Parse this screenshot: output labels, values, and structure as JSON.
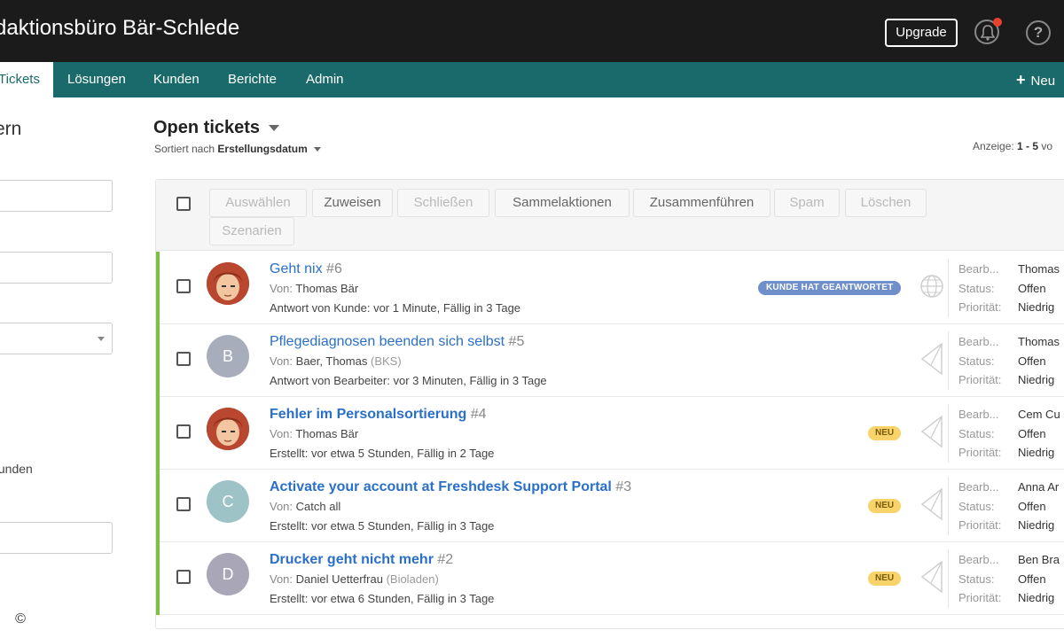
{
  "header": {
    "brand": "daktionsbüro Bär-Schlede",
    "upgrade_label": "Upgrade",
    "help_glyph": "?"
  },
  "nav": {
    "items": [
      {
        "label": "Tickets",
        "active": true
      },
      {
        "label": "Lösungen"
      },
      {
        "label": "Kunden"
      },
      {
        "label": "Berichte"
      },
      {
        "label": "Admin"
      }
    ],
    "new_icon": "+",
    "new_label": "Neu"
  },
  "sidebar": {
    "title": "ern",
    "text": "tunden",
    "copyright": "©"
  },
  "main": {
    "title": "Open tickets",
    "sort_prefix": "Sortiert nach",
    "sort_value": "Erstellungsdatum",
    "display_prefix": "Anzeige:",
    "display_value": "1 - 5",
    "display_suffix": "vo"
  },
  "toolbar": {
    "buttons": [
      "Auswählen",
      "Zuweisen",
      "Schließen",
      "Sammelaktionen",
      "Zusammenführen",
      "Spam",
      "Löschen",
      "Szenarien"
    ]
  },
  "props_labels": {
    "agent": "Bearb...",
    "status": "Status:",
    "priority": "Priorität:"
  },
  "tickets": [
    {
      "title": "Geht nix",
      "number": "#6",
      "from_label": "Von:",
      "from": "Thomas Bär",
      "org": "",
      "meta": "Antwort von Kunde: vor 1 Minute, Fällig in 3 Tage",
      "badge": "KUNDE HAT GEANTWORTET",
      "agent": "Thomas",
      "status": "Offen",
      "priority": "Niedrig"
    },
    {
      "title": "Pflegediagnosen beenden sich selbst",
      "number": "#5",
      "from_label": "Von:",
      "from": "Baer, Thomas",
      "org": "(BKS)",
      "meta": "Antwort von Bearbeiter: vor 3 Minuten, Fällig in 3 Tage",
      "avatar_letter": "B",
      "agent": "Thomas",
      "status": "Offen",
      "priority": "Niedrig"
    },
    {
      "title": "Fehler im Personalsortierung",
      "number": "#4",
      "from_label": "Von:",
      "from": "Thomas Bär",
      "org": "",
      "meta": "Erstellt: vor etwa 5 Stunden, Fällig in 2 Tage",
      "badge": "NEU",
      "agent": "Cem Cu",
      "status": "Offen",
      "priority": "Niedrig"
    },
    {
      "title": "Activate your account at Freshdesk Support Portal",
      "number": "#3",
      "from_label": "Von:",
      "from": "Catch all",
      "org": "",
      "meta": "Erstellt: vor etwa 5 Stunden, Fällig in 3 Tage",
      "badge": "NEU",
      "avatar_letter": "C",
      "agent": "Anna Ar",
      "status": "Offen",
      "priority": "Niedrig"
    },
    {
      "title": "Drucker geht nicht mehr",
      "number": "#2",
      "from_label": "Von:",
      "from": "Daniel Uetterfrau",
      "org": "(Bioladen)",
      "meta": "Erstellt: vor etwa 6 Stunden, Fällig in 3 Tage",
      "badge": "NEU",
      "avatar_letter": "D",
      "agent": "Ben Bra",
      "status": "Offen",
      "priority": "Niedrig"
    }
  ],
  "colors": {
    "topbar": "#1b1b1b",
    "nav": "#1a6a6b",
    "accent_bar": "#7cc242",
    "link": "#2a6fc9",
    "badge_blue": "#6e8fc9",
    "badge_new": "#f7d36a"
  }
}
